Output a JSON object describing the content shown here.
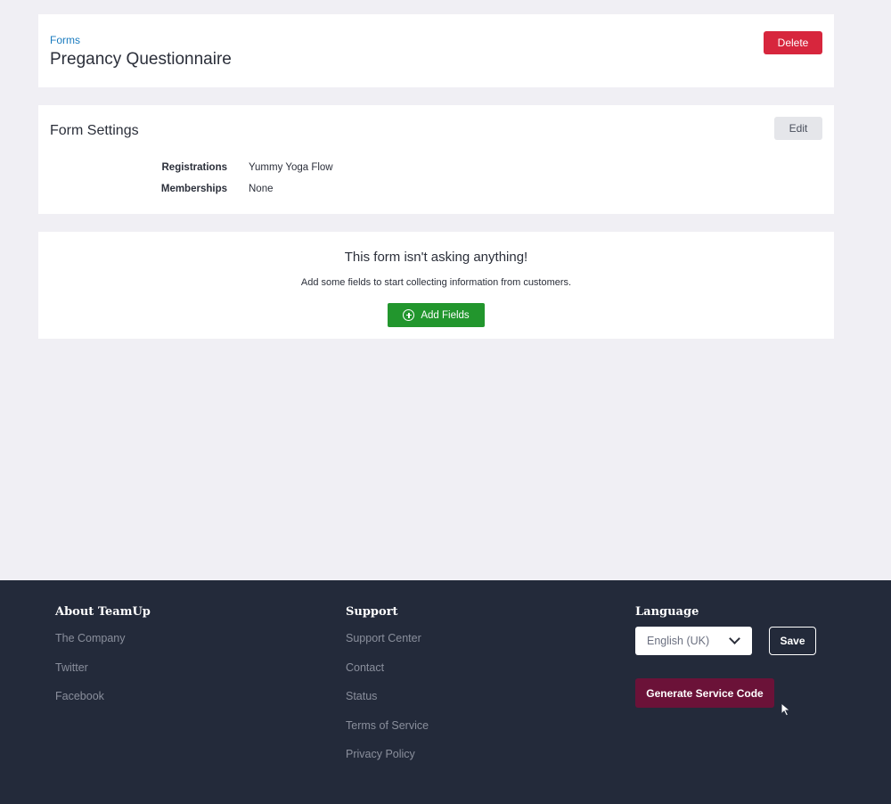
{
  "header": {
    "breadcrumb": "Forms",
    "title": "Pregancy Questionnaire",
    "delete_label": "Delete"
  },
  "settings": {
    "title": "Form Settings",
    "edit_label": "Edit",
    "rows": [
      {
        "label": "Registrations",
        "value": "Yummy Yoga Flow"
      },
      {
        "label": "Memberships",
        "value": "None"
      }
    ]
  },
  "fields": {
    "empty_title": "This form isn't asking anything!",
    "empty_subtitle": "Add some fields to start collecting information from customers.",
    "add_label": "Add Fields"
  },
  "footer": {
    "about": {
      "heading": "About TeamUp",
      "links": [
        "The Company",
        "Twitter",
        "Facebook"
      ]
    },
    "support": {
      "heading": "Support",
      "links": [
        "Support Center",
        "Contact",
        "Status",
        "Terms of Service",
        "Privacy Policy"
      ]
    },
    "language": {
      "heading": "Language",
      "selected": "English (UK)",
      "save_label": "Save",
      "generate_label": "Generate Service Code"
    }
  },
  "colors": {
    "delete": "#d7263d",
    "add": "#22962d",
    "footer_bg": "#232a3a",
    "generate": "#6b1238",
    "link": "#1a7bbf"
  },
  "icons": {
    "add_icon": "plus-circle-icon",
    "select_icon": "chevron-down-icon",
    "cursor": "mouse-pointer-icon"
  }
}
